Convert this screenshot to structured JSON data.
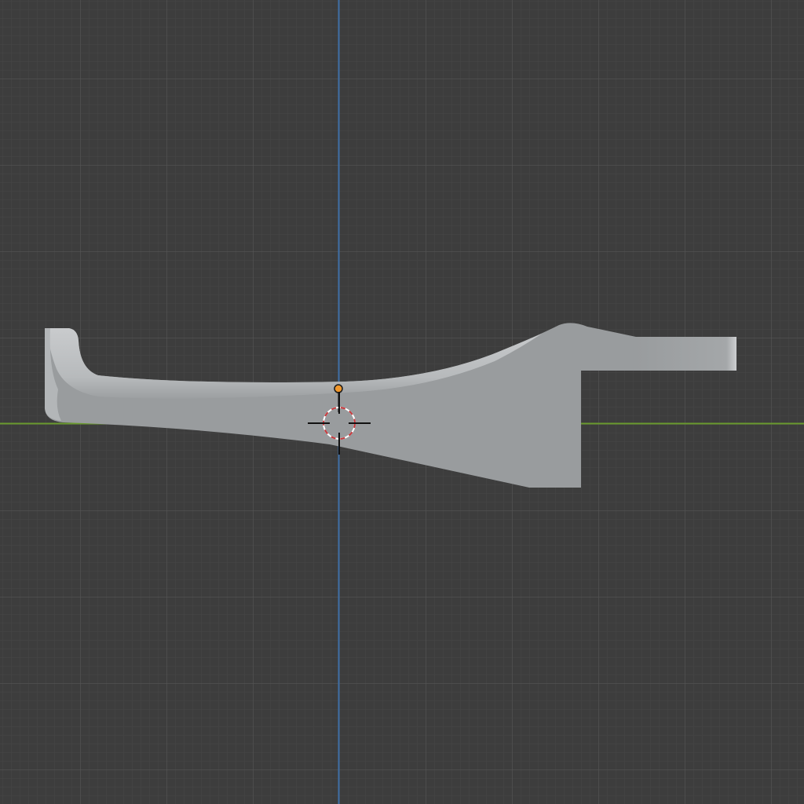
{
  "viewport": {
    "view": "front-orthographic",
    "background_color": "#3d3d3d",
    "grid": {
      "minor_color": "#464646",
      "major_color": "#545454",
      "visible": true
    },
    "axes": {
      "x_axis_color": "#6a9a2e",
      "z_axis_color": "#3f6fa6"
    }
  },
  "object": {
    "kind": "mesh",
    "shading": "solid",
    "base_color": "#999c9e",
    "highlight_color": "#c9cbcd",
    "origin_color": "#f0972c"
  },
  "cursor": {
    "name": "3d-cursor",
    "ring_colors": [
      "#c8383c",
      "#ffffff"
    ]
  }
}
